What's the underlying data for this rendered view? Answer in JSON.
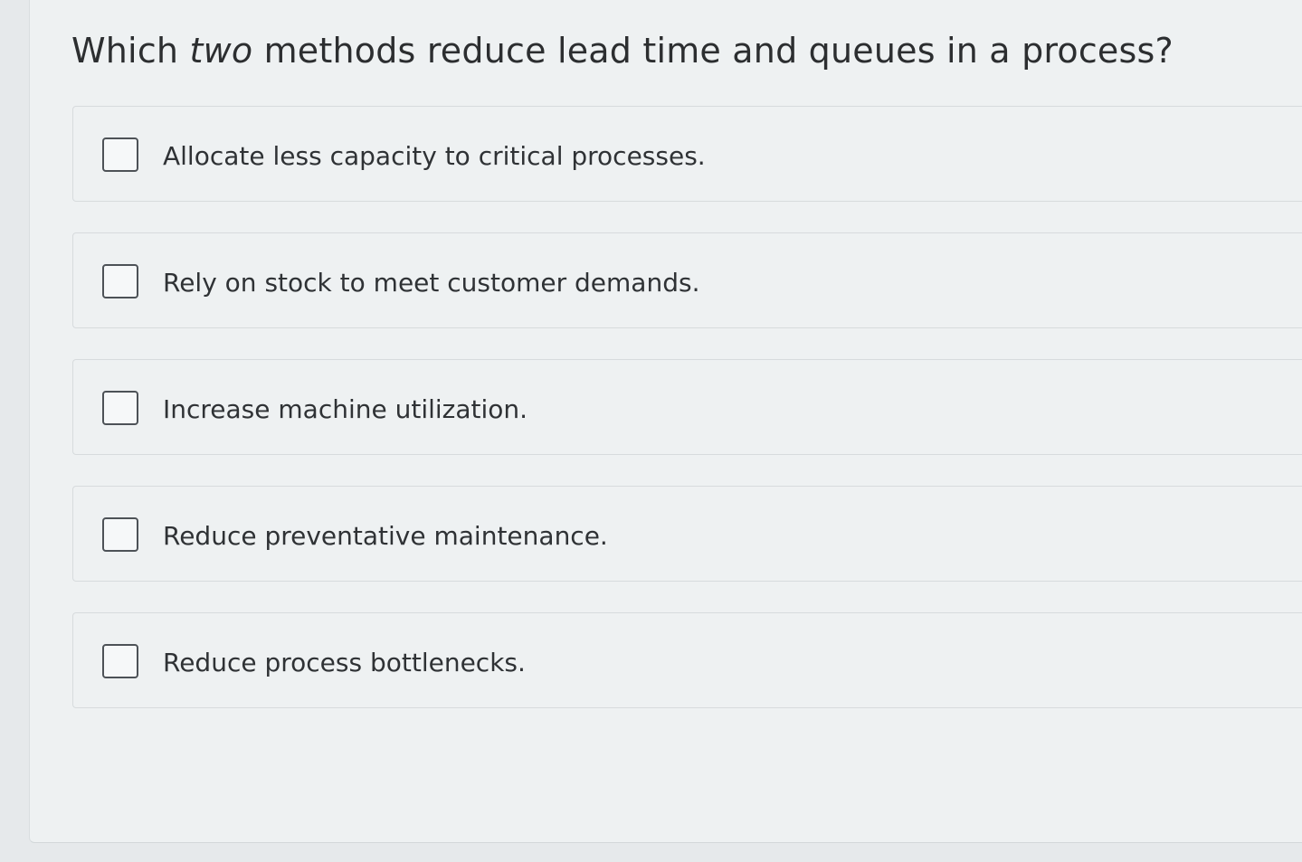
{
  "question": {
    "prefix": "Which ",
    "emphasis": "two",
    "suffix": " methods reduce lead time and queues in a process?"
  },
  "options": [
    {
      "label": "Allocate less capacity to critical processes.",
      "checked": false
    },
    {
      "label": "Rely on stock to meet customer demands.",
      "checked": false
    },
    {
      "label": "Increase machine utilization.",
      "checked": false
    },
    {
      "label": "Reduce preventative maintenance.",
      "checked": false
    },
    {
      "label": "Reduce process bottlenecks.",
      "checked": false
    }
  ],
  "colors": {
    "background": "#e6e9eb",
    "panel": "#eef1f2",
    "text": "#2c2e30",
    "checkbox_border": "#4d5257"
  }
}
